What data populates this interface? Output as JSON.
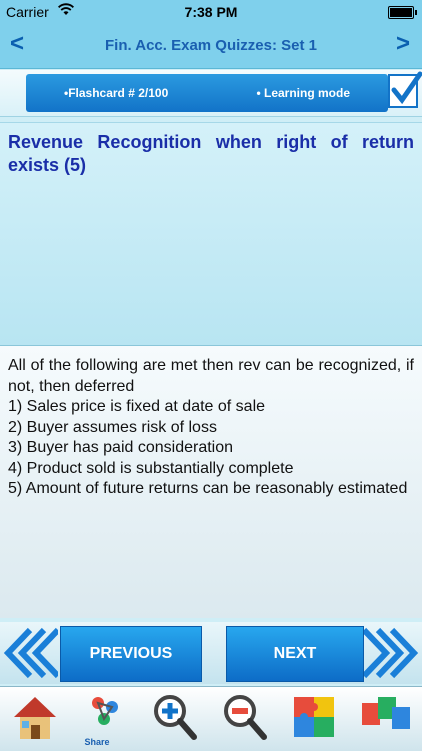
{
  "status": {
    "carrier": "Carrier",
    "time": "7:38 PM"
  },
  "nav": {
    "back": "<",
    "title": "Fin. Acc. Exam Quizzes: Set 1",
    "forward": ">"
  },
  "info": {
    "flashcard": "•Flashcard #  2/100",
    "mode": "• Learning mode"
  },
  "question": "Revenue Recognition when right of return exists (5)",
  "answer": {
    "lines": [
      "All of the following are met then rev can be recognized, if not, then deferred",
      "1) Sales price is fixed at date of sale",
      "2) Buyer assumes risk of loss",
      "3) Buyer has paid consideration",
      "4) Product sold is substantially complete",
      "5) Amount of future returns can be reasonably estimated"
    ]
  },
  "buttons": {
    "previous": "PREVIOUS",
    "next": "NEXT"
  },
  "tabs": [
    {
      "icon": "home-icon"
    },
    {
      "icon": "share-icon",
      "label": "Share"
    },
    {
      "icon": "zoom-in-icon"
    },
    {
      "icon": "zoom-out-icon"
    },
    {
      "icon": "puzzle-icon"
    },
    {
      "icon": "abc-icon"
    }
  ],
  "colors": {
    "accent": "#1273c8",
    "nav_bg": "#7fd0ec",
    "question_text": "#1a2ea8"
  }
}
